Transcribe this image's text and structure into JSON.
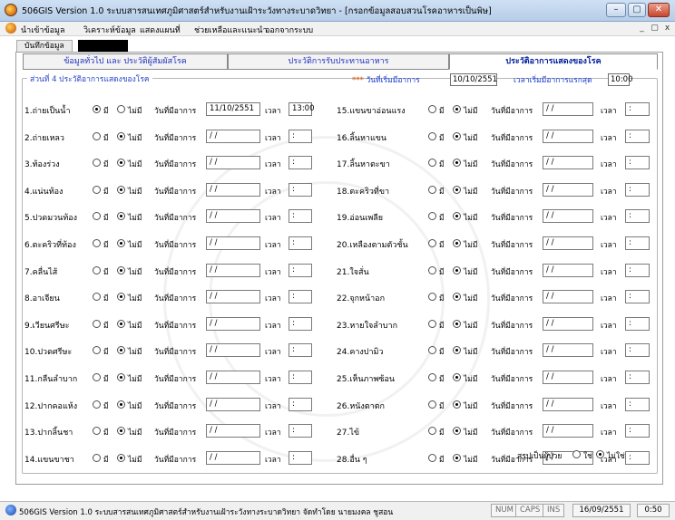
{
  "window": {
    "title": "506GIS Version 1.0  ระบบสารสนเทศภูมิศาสตร์สำหรับงานเฝ้าระวังทางระบาดวิทยา - [กรอกข้อมูลสอบสวนโรคอาหารเป็นพิษ]",
    "buttons": {
      "minimize": "–",
      "restore": "▢",
      "close": "✕"
    }
  },
  "menu": {
    "items": [
      "นำเข้าข้อมูล",
      "วิเคราะห์ข้อมูล",
      "แสดงแผนที่",
      "ช่วยเหลือและแนะนำ",
      "ออกจากระบบ"
    ],
    "mdi": {
      "minimize": "_",
      "restore": "▢",
      "close": "x"
    }
  },
  "page_tab": "บันทึกข้อมูล",
  "tabs": [
    "ข้อมูลทั่วไป และ ประวัติผู้สัมผัสโรค",
    "ประวัติการรับประทานอาหาร",
    "ประวัติอาการแสดงของโรค"
  ],
  "section": {
    "legend": "ส่วนที่ 4 ประวัติอาการแสดงของโรค",
    "start_required": "***",
    "start_label": "วันที่เริ่มมีอาการ",
    "start_date": "10/10/2551",
    "first_time_label": "เวลาเริ่มมีอาการแรกสุด",
    "first_time": "10:00"
  },
  "labels": {
    "yes": "มี",
    "no": "ไม่มี",
    "date": "วันที่มีอาการ",
    "time": "เวลา"
  },
  "symptoms_left": [
    {
      "name": "1.ถ่ายเป็นน้ำ",
      "has": true,
      "date": "11/10/2551",
      "time": "13:00"
    },
    {
      "name": "2.ถ่ายเหลว",
      "has": false,
      "date": "/ /",
      "time": ":"
    },
    {
      "name": "3.ท้องร่วง",
      "has": false,
      "date": "/ /",
      "time": ":"
    },
    {
      "name": "4.แน่นท้อง",
      "has": false,
      "date": "/ /",
      "time": ":"
    },
    {
      "name": "5.ปวดมวนท้อง",
      "has": false,
      "date": "/ /",
      "time": ":"
    },
    {
      "name": "6.ตะคริวที่ท้อง",
      "has": false,
      "date": "/ /",
      "time": ":"
    },
    {
      "name": "7.คลื่นไส้",
      "has": false,
      "date": "/ /",
      "time": ":"
    },
    {
      "name": "8.อาเจียน",
      "has": false,
      "date": "/ /",
      "time": ":"
    },
    {
      "name": "9.เวียนศรีษะ",
      "has": false,
      "date": "/ /",
      "time": ":"
    },
    {
      "name": "10.ปวดศรีษะ",
      "has": false,
      "date": "/ /",
      "time": ":"
    },
    {
      "name": "11.กลืนลำบาก",
      "has": false,
      "date": "/ /",
      "time": ":"
    },
    {
      "name": "12.ปากคอแห้ง",
      "has": false,
      "date": "/ /",
      "time": ":"
    },
    {
      "name": "13.ปากลิ้นชา",
      "has": false,
      "date": "/ /",
      "time": ":"
    },
    {
      "name": "14.แขนขาชา",
      "has": false,
      "date": "/ /",
      "time": ":"
    }
  ],
  "symptoms_right": [
    {
      "name": "15.แขนขาอ่อนแรง",
      "has": false,
      "date": "/ /",
      "time": ":"
    },
    {
      "name": "16.ลิ้นหาแขน",
      "has": false,
      "date": "/ /",
      "time": ":"
    },
    {
      "name": "17.ลิ้นหาตะขา",
      "has": false,
      "date": "/ /",
      "time": ":"
    },
    {
      "name": "18.ตะคริวที่ขา",
      "has": false,
      "date": "/ /",
      "time": ":"
    },
    {
      "name": "19.อ่อนเพลีย",
      "has": false,
      "date": "/ /",
      "time": ":"
    },
    {
      "name": "20.เหลืองตามตัวชั้น",
      "has": false,
      "date": "/ /",
      "time": ":"
    },
    {
      "name": "21.ใจสั่น",
      "has": false,
      "date": "/ /",
      "time": ":"
    },
    {
      "name": "22.จุกหน้าอก",
      "has": false,
      "date": "/ /",
      "time": ":"
    },
    {
      "name": "23.หายใจลำบาก",
      "has": false,
      "date": "/ /",
      "time": ":"
    },
    {
      "name": "24.คางปามิว",
      "has": false,
      "date": "/ /",
      "time": ":"
    },
    {
      "name": "25.เห็นภาพซ้อน",
      "has": false,
      "date": "/ /",
      "time": ":"
    },
    {
      "name": "26.หนังตาตก",
      "has": false,
      "date": "/ /",
      "time": ":"
    },
    {
      "name": "27.ไข้",
      "has": false,
      "date": "/ /",
      "time": ":"
    },
    {
      "name": "28.อื่น ๆ",
      "has": false,
      "date": "/ /",
      "time": ":"
    }
  ],
  "ask": {
    "label": "สรุปเป็นผู้ป่วย",
    "yes": "ใช่",
    "no": "ไม่ใช่",
    "selected": "no"
  },
  "status": {
    "text": "506GIS Version 1.0 ระบบสารสนเทศภูมิศาสตร์สำหรับงานเฝ้าระวังทางระบาดวิทยา จัดทำโดย นายมงคล ชูสอน",
    "num": "NUM",
    "caps": "CAPS",
    "ins": "INS",
    "date": "16/09/2551",
    "time": "0:50"
  }
}
